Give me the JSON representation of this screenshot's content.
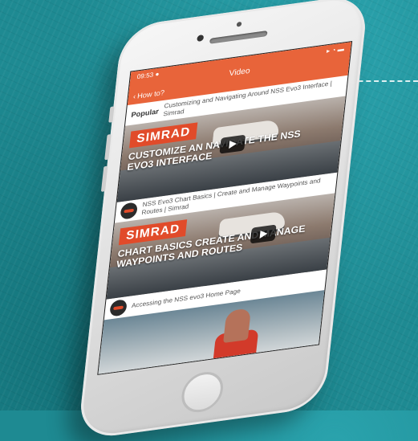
{
  "status_bar": {
    "left": "09:53 ●",
    "right": "▸ ◔ ▬"
  },
  "app": {
    "title": "Video",
    "back_label": "How to?"
  },
  "section_label": "Popular",
  "videos": [
    {
      "title": "Customizing and Navigating Around NSS Evo3 Interface | Simrad",
      "brand": "SIMRAD",
      "overlay": "Customize an navigate the NSS Evo3 interface"
    },
    {
      "title": "NSS Evo3 Chart Basics | Create and Manage Waypoints and Routes | Simrad",
      "brand": "SIMRAD",
      "overlay": "Chart basics create and manage waypoints and routes"
    },
    {
      "title": "Accessing the NSS evo3 Home Page"
    }
  ],
  "icons": {
    "back": "chevron-left-icon",
    "play": "play-icon",
    "channel": "simrad-channel-avatar"
  },
  "colors": {
    "app_bar": "#e8643a",
    "brand": "#e14b2a",
    "background": "#1e8a92"
  }
}
